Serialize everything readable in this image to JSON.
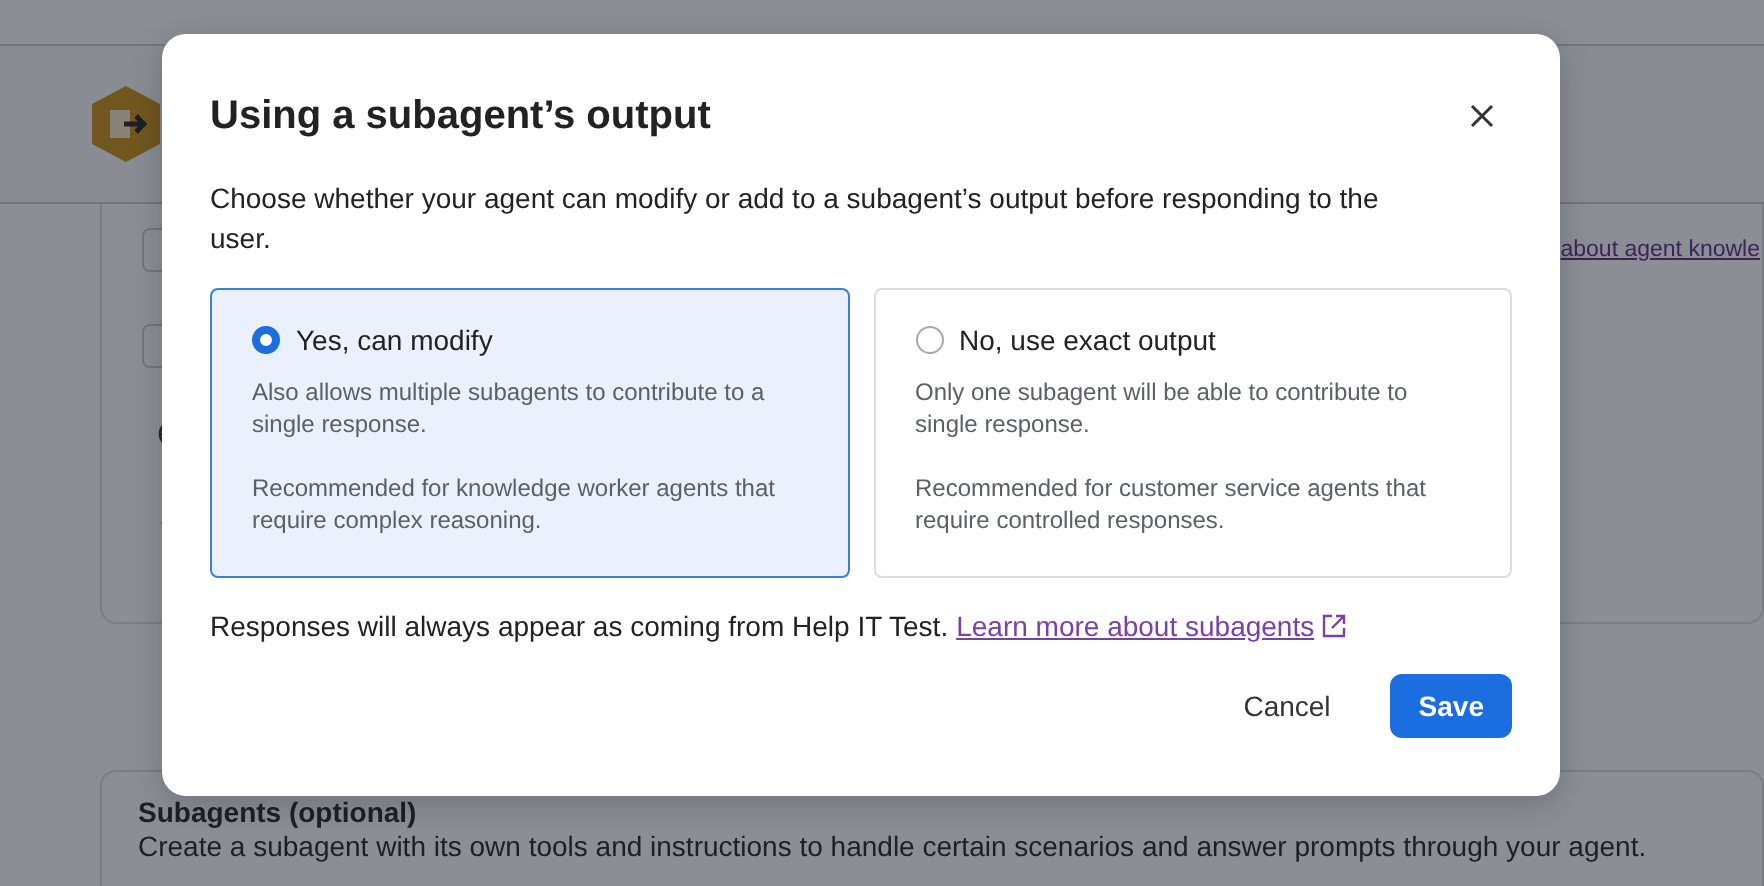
{
  "background": {
    "link": "about agent knowle",
    "section_title": "Subagents (optional)",
    "section_description": "Create a subagent with its own tools and instructions to handle certain scenarios and answer prompts through your agent."
  },
  "dialog": {
    "title": "Using a subagent’s output",
    "description": "Choose whether your agent can modify or add to a subagent’s output before responding to the user.",
    "options": [
      {
        "label": "Yes, can modify",
        "description": "Also allows multiple subagents to contribute to a single response.",
        "recommendation": "Recommended for knowledge worker agents that require complex reasoning.",
        "selected": true
      },
      {
        "label": "No, use exact output",
        "description": "Only one subagent will be able to contribute to single response.",
        "recommendation": "Recommended for customer service agents that require controlled responses.",
        "selected": false
      }
    ],
    "footer_text": "Responses will always appear as coming from Help IT Test.",
    "link": "Learn more about subagents",
    "buttons": [
      {
        "label": "Cancel",
        "kind": "secondary"
      },
      {
        "label": "Save",
        "kind": "primary"
      }
    ]
  }
}
